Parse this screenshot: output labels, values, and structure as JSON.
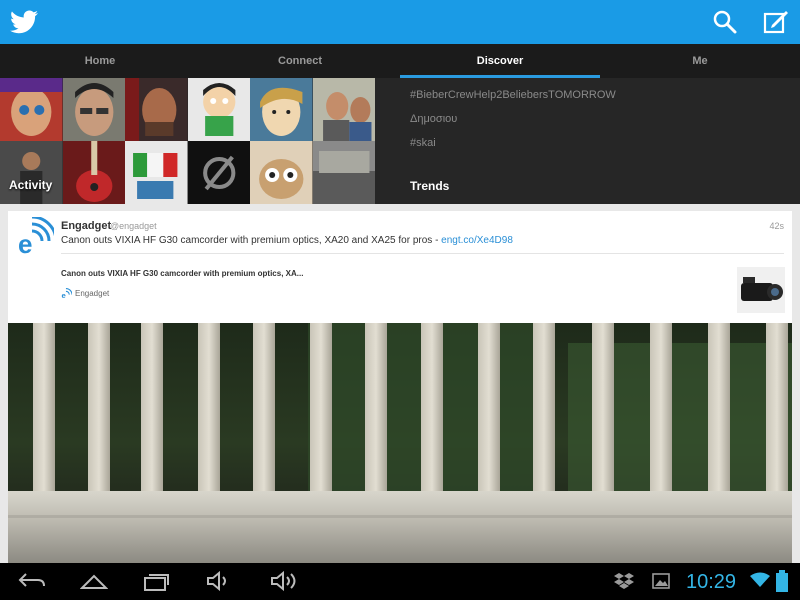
{
  "app": {
    "logo_icon": "twitter-bird-icon",
    "search_icon": "search-icon",
    "compose_icon": "compose-icon",
    "brand_color": "#1a9be6"
  },
  "tabs": [
    {
      "label": "Home",
      "active": false
    },
    {
      "label": "Connect",
      "active": false
    },
    {
      "label": "Discover",
      "active": true
    },
    {
      "label": "Me",
      "active": false
    }
  ],
  "discover": {
    "activity_label": "Activity",
    "trends": [
      "#BieberCrewHelp2BeliebersTOMORROW",
      "Δημοσιου",
      "#skai"
    ],
    "trends_title": "Trends"
  },
  "tweet": {
    "name": "Engadget",
    "handle": "@engadget",
    "time": "42s",
    "text": "Canon outs VIXIA HF G30 camcorder with premium optics, XA20 and XA25 for pros - ",
    "link": "engt.co/Xe4D98",
    "preview_title": "Canon outs VIXIA HF G30 camcorder with premium optics, XA...",
    "preview_source": "Engadget"
  },
  "statusbar": {
    "time": "10:29",
    "accent": "#33b5e5"
  }
}
